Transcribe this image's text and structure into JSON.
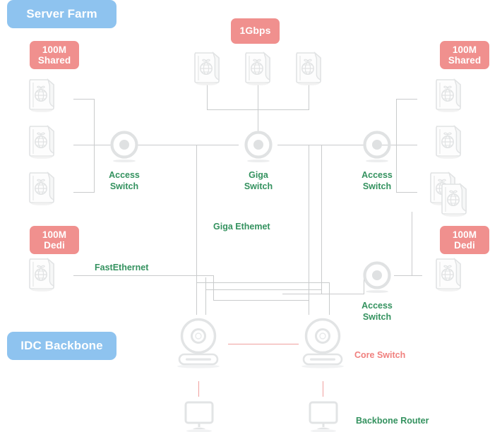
{
  "diagram": {
    "title": "Server Farm / IDC Backbone network topology",
    "colors": {
      "zone_badge": "#8ec3ef",
      "speed_badge": "#f0908e",
      "device_label": "#34925f",
      "core_label": "#f0807e",
      "link_line": "#c9cbcc",
      "core_link_line": "#f0a09e",
      "icon_outline": "#e3e5e6"
    },
    "zone_badges": [
      {
        "id": "server-farm",
        "label": "Server Farm"
      },
      {
        "id": "idc-backbone",
        "label": "IDC Backbone"
      }
    ],
    "speed_badges": [
      {
        "id": "left-shared",
        "label": "100M\nShared"
      },
      {
        "id": "top-gbps",
        "label": "1Gbps"
      },
      {
        "id": "right-shared",
        "label": "100M\nShared"
      },
      {
        "id": "left-dedi",
        "label": "100M\nDedi"
      },
      {
        "id": "right-dedi",
        "label": "100M\nDedi"
      }
    ],
    "devices": [
      {
        "id": "access-switch-left",
        "label": "Access\nSwitch",
        "type": "switch"
      },
      {
        "id": "giga-switch",
        "label": "Giga\nSwitch",
        "type": "switch"
      },
      {
        "id": "access-switch-right-top",
        "label": "Access\nSwitch",
        "type": "switch"
      },
      {
        "id": "access-switch-right-bottom",
        "label": "Access\nSwitch",
        "type": "switch"
      },
      {
        "id": "core-switch",
        "label": "Core Switch",
        "type": "core-switch"
      },
      {
        "id": "backbone-router",
        "label": "Backbone Router",
        "type": "router"
      }
    ],
    "link_labels": [
      {
        "id": "giga-ethernet",
        "label": "Giga Ethemet"
      },
      {
        "id": "fast-ethernet",
        "label": "FastEthernet"
      }
    ],
    "server_groups": [
      {
        "id": "left-shared-servers",
        "count": 3
      },
      {
        "id": "top-giga-servers",
        "count": 3
      },
      {
        "id": "right-shared-servers",
        "count": 4
      },
      {
        "id": "left-dedi-server",
        "count": 1
      },
      {
        "id": "right-dedi-server",
        "count": 1
      }
    ]
  }
}
